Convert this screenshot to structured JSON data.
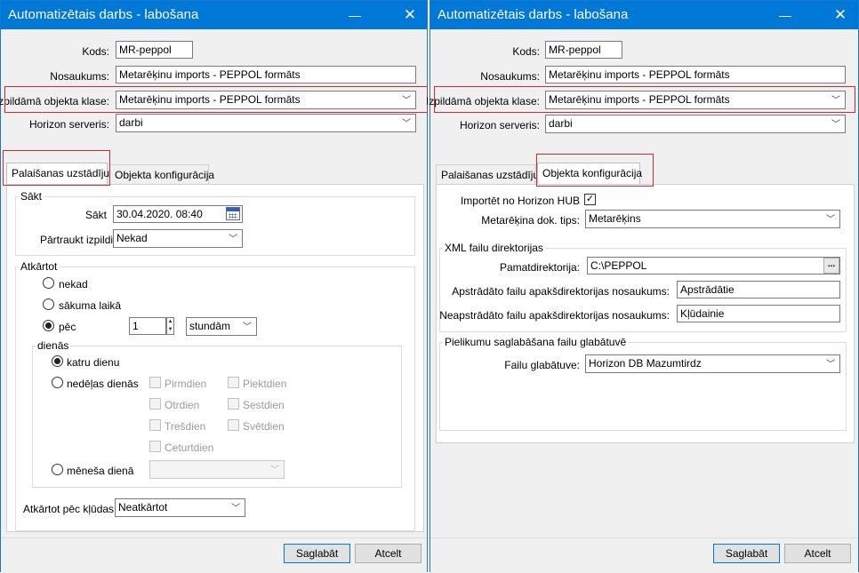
{
  "left": {
    "title": "Automatizētais darbs - labošana",
    "kods_label": "Kods:",
    "kods_value": "MR-peppol",
    "nosaukums_label": "Nosaukums:",
    "nosaukums_value": "Metarēķinu imports - PEPPOL formāts",
    "klase_label": "Izpildāmā objekta klase:",
    "klase_value": "Metarēķinu imports - PEPPOL formāts",
    "serveris_label": "Horizon serveris:",
    "serveris_value": "darbi",
    "tab1": "Palaišanas uzstādījumi",
    "tab2": "Objekta konfigurācija",
    "sakt_group": "Sākt",
    "sakt_label": "Sākt",
    "sakt_value": "30.04.2020. 08:40",
    "partraukt_label": "Pārtraukt izpildi",
    "partraukt_value": "Nekad",
    "atkartot_group": "Atkārtot",
    "r_nekad": "nekad",
    "r_sakuma": "sākuma laikā",
    "r_pec": "pēc",
    "pec_value": "1",
    "pec_unit": "stundām",
    "dienas_group": "dienās",
    "r_katru": "katru dienu",
    "r_nedelas": "nedēļas dienās",
    "days": {
      "pirmdien": "Pirmdien",
      "otrdien": "Otrdien",
      "tresdien": "Trešdien",
      "ceturtdien": "Ceturtdien",
      "piektdien": "Piektdien",
      "sestdien": "Sestdien",
      "svetdien": "Svētdien"
    },
    "r_menesa": "mēneša dienā",
    "kludas_label": "Atkārtot pēc kļūdas",
    "kludas_value": "Neatkārtot",
    "save": "Saglabāt",
    "cancel": "Atcelt"
  },
  "right": {
    "title": "Automatizētais darbs - labošana",
    "kods_label": "Kods:",
    "kods_value": "MR-peppol",
    "nosaukums_label": "Nosaukums:",
    "nosaukums_value": "Metarēķinu imports - PEPPOL formāts",
    "klase_label": "Izpildāmā objekta klase:",
    "klase_value": "Metarēķinu imports - PEPPOL formāts",
    "serveris_label": "Horizon serveris:",
    "serveris_value": "darbi",
    "tab1": "Palaišanas uzstādījumi",
    "tab2": "Objekta konfigurācija",
    "hub_label": "Importēt no Horizon HUB",
    "hub_checked": "✓",
    "tips_label": "Metarēķina dok. tips:",
    "tips_value": "Metarēķins",
    "xml_group": "XML failu direktorijas",
    "pamat_label": "Pamatdirektorija:",
    "pamat_value": "C:\\PEPPOL",
    "apstr_label": "Apstrādāto failu apakšdirektorijas nosaukums:",
    "apstr_value": "Apstrādātie",
    "neapstr_label": "Neapstrādāto failu apakšdirektorijas nosaukums:",
    "neapstr_value": "Kļūdainie",
    "pielikumu_group": "Pielikumu saglabāšana failu glabātuvē",
    "glab_label": "Failu glabātuve:",
    "glab_value": "Horizon DB Mazumtirdz",
    "save": "Saglabāt",
    "cancel": "Atcelt"
  },
  "icons": {
    "close": "✕",
    "minimize": "—",
    "chevron": "﹀",
    "spin_up": "▲",
    "spin_down": "▼",
    "dots": "..."
  },
  "colors": {
    "titlebar": "#0078d7",
    "highlight": "#d8272e"
  }
}
